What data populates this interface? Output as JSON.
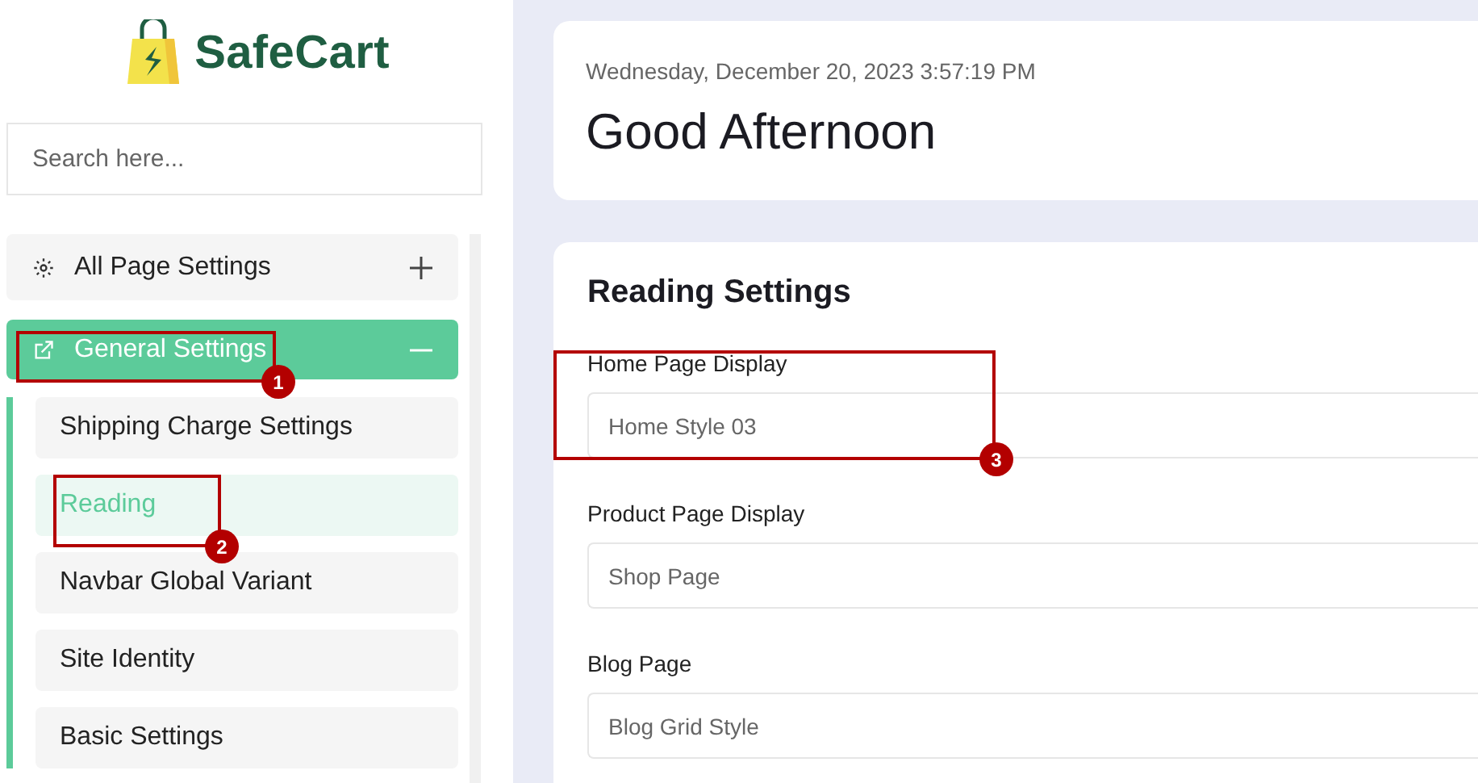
{
  "brand": {
    "name": "SafeCart"
  },
  "search": {
    "placeholder": "Search here..."
  },
  "menu": [
    {
      "label": "All Page Settings",
      "kind": "gear",
      "expanded": false,
      "selected": false
    },
    {
      "label": "General Settings",
      "kind": "link",
      "expanded": true,
      "selected": true,
      "children": [
        {
          "label": "Shipping Charge Settings",
          "selected": false
        },
        {
          "label": "Reading",
          "selected": true
        },
        {
          "label": "Navbar Global Variant",
          "selected": false
        },
        {
          "label": "Site Identity",
          "selected": false
        },
        {
          "label": "Basic Settings",
          "selected": false
        }
      ]
    }
  ],
  "header": {
    "datetime": "Wednesday, December 20, 2023 3:57:19 PM",
    "greeting": "Good Afternoon"
  },
  "settings": {
    "title": "Reading Settings",
    "fields": [
      {
        "label": "Home Page Display",
        "value": "Home Style 03"
      },
      {
        "label": "Product Page Display",
        "value": "Shop Page"
      },
      {
        "label": "Blog Page",
        "value": "Blog Grid Style"
      }
    ]
  },
  "annotations": [
    {
      "number": "1",
      "kind": "menu"
    },
    {
      "number": "2",
      "kind": "submenu"
    },
    {
      "number": "3",
      "kind": "field"
    }
  ]
}
